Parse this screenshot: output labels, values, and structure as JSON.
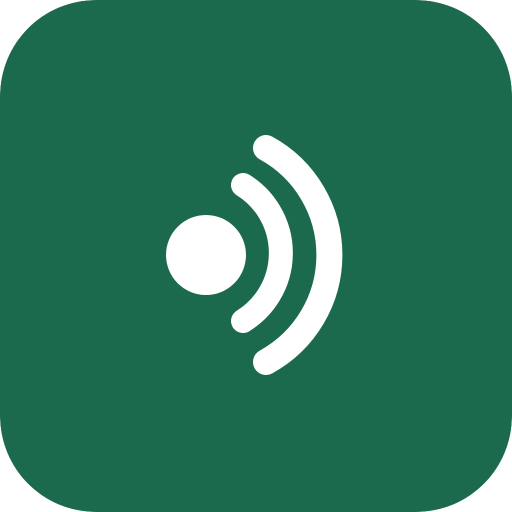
{
  "app_icon": {
    "icon": "broadcast-signal-icon",
    "colors": {
      "background": "#1C6A4D",
      "glyph": "#FFFFFF"
    }
  }
}
